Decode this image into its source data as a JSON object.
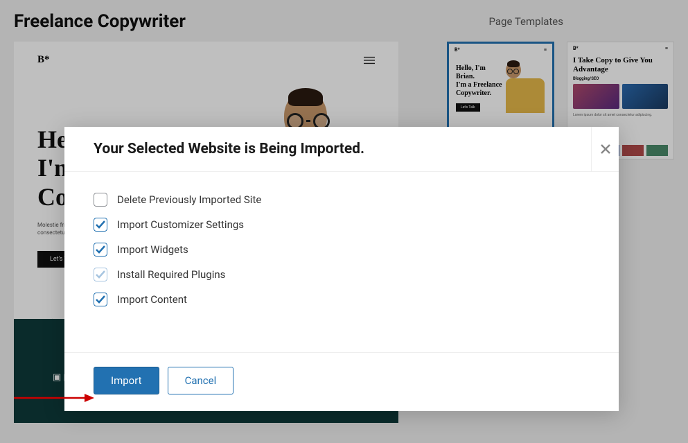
{
  "page": {
    "title": "Freelance Copywriter",
    "templates_label": "Page Templates"
  },
  "preview": {
    "logo": "B*",
    "hero_line1": "Hello, I'm Brian.",
    "hero_line2": "I'm a Freelance",
    "hero_line3": "Copywriter.",
    "sub": "Molestie fringilla lorem ipsum dolor sit amet consectetur. Felis lorem in amet.",
    "cta": "Let's Talk"
  },
  "thumbs": {
    "t1": {
      "logo": "B*",
      "h1": "Hello, I'm Brian.",
      "h2": "I'm a Freelance",
      "h3": "Copywriter.",
      "cta": "Let's Talk"
    },
    "t2": {
      "logo": "B*",
      "title": "I Take Copy to Give You Advantage",
      "sub": "Blogging/SEO"
    }
  },
  "modal": {
    "title": "Your Selected Website is Being Imported.",
    "options": {
      "delete": "Delete Previously Imported Site",
      "customizer": "Import Customizer Settings",
      "widgets": "Import Widgets",
      "plugins": "Install Required Plugins",
      "content": "Import Content"
    },
    "import_btn": "Import",
    "cancel_btn": "Cancel"
  }
}
